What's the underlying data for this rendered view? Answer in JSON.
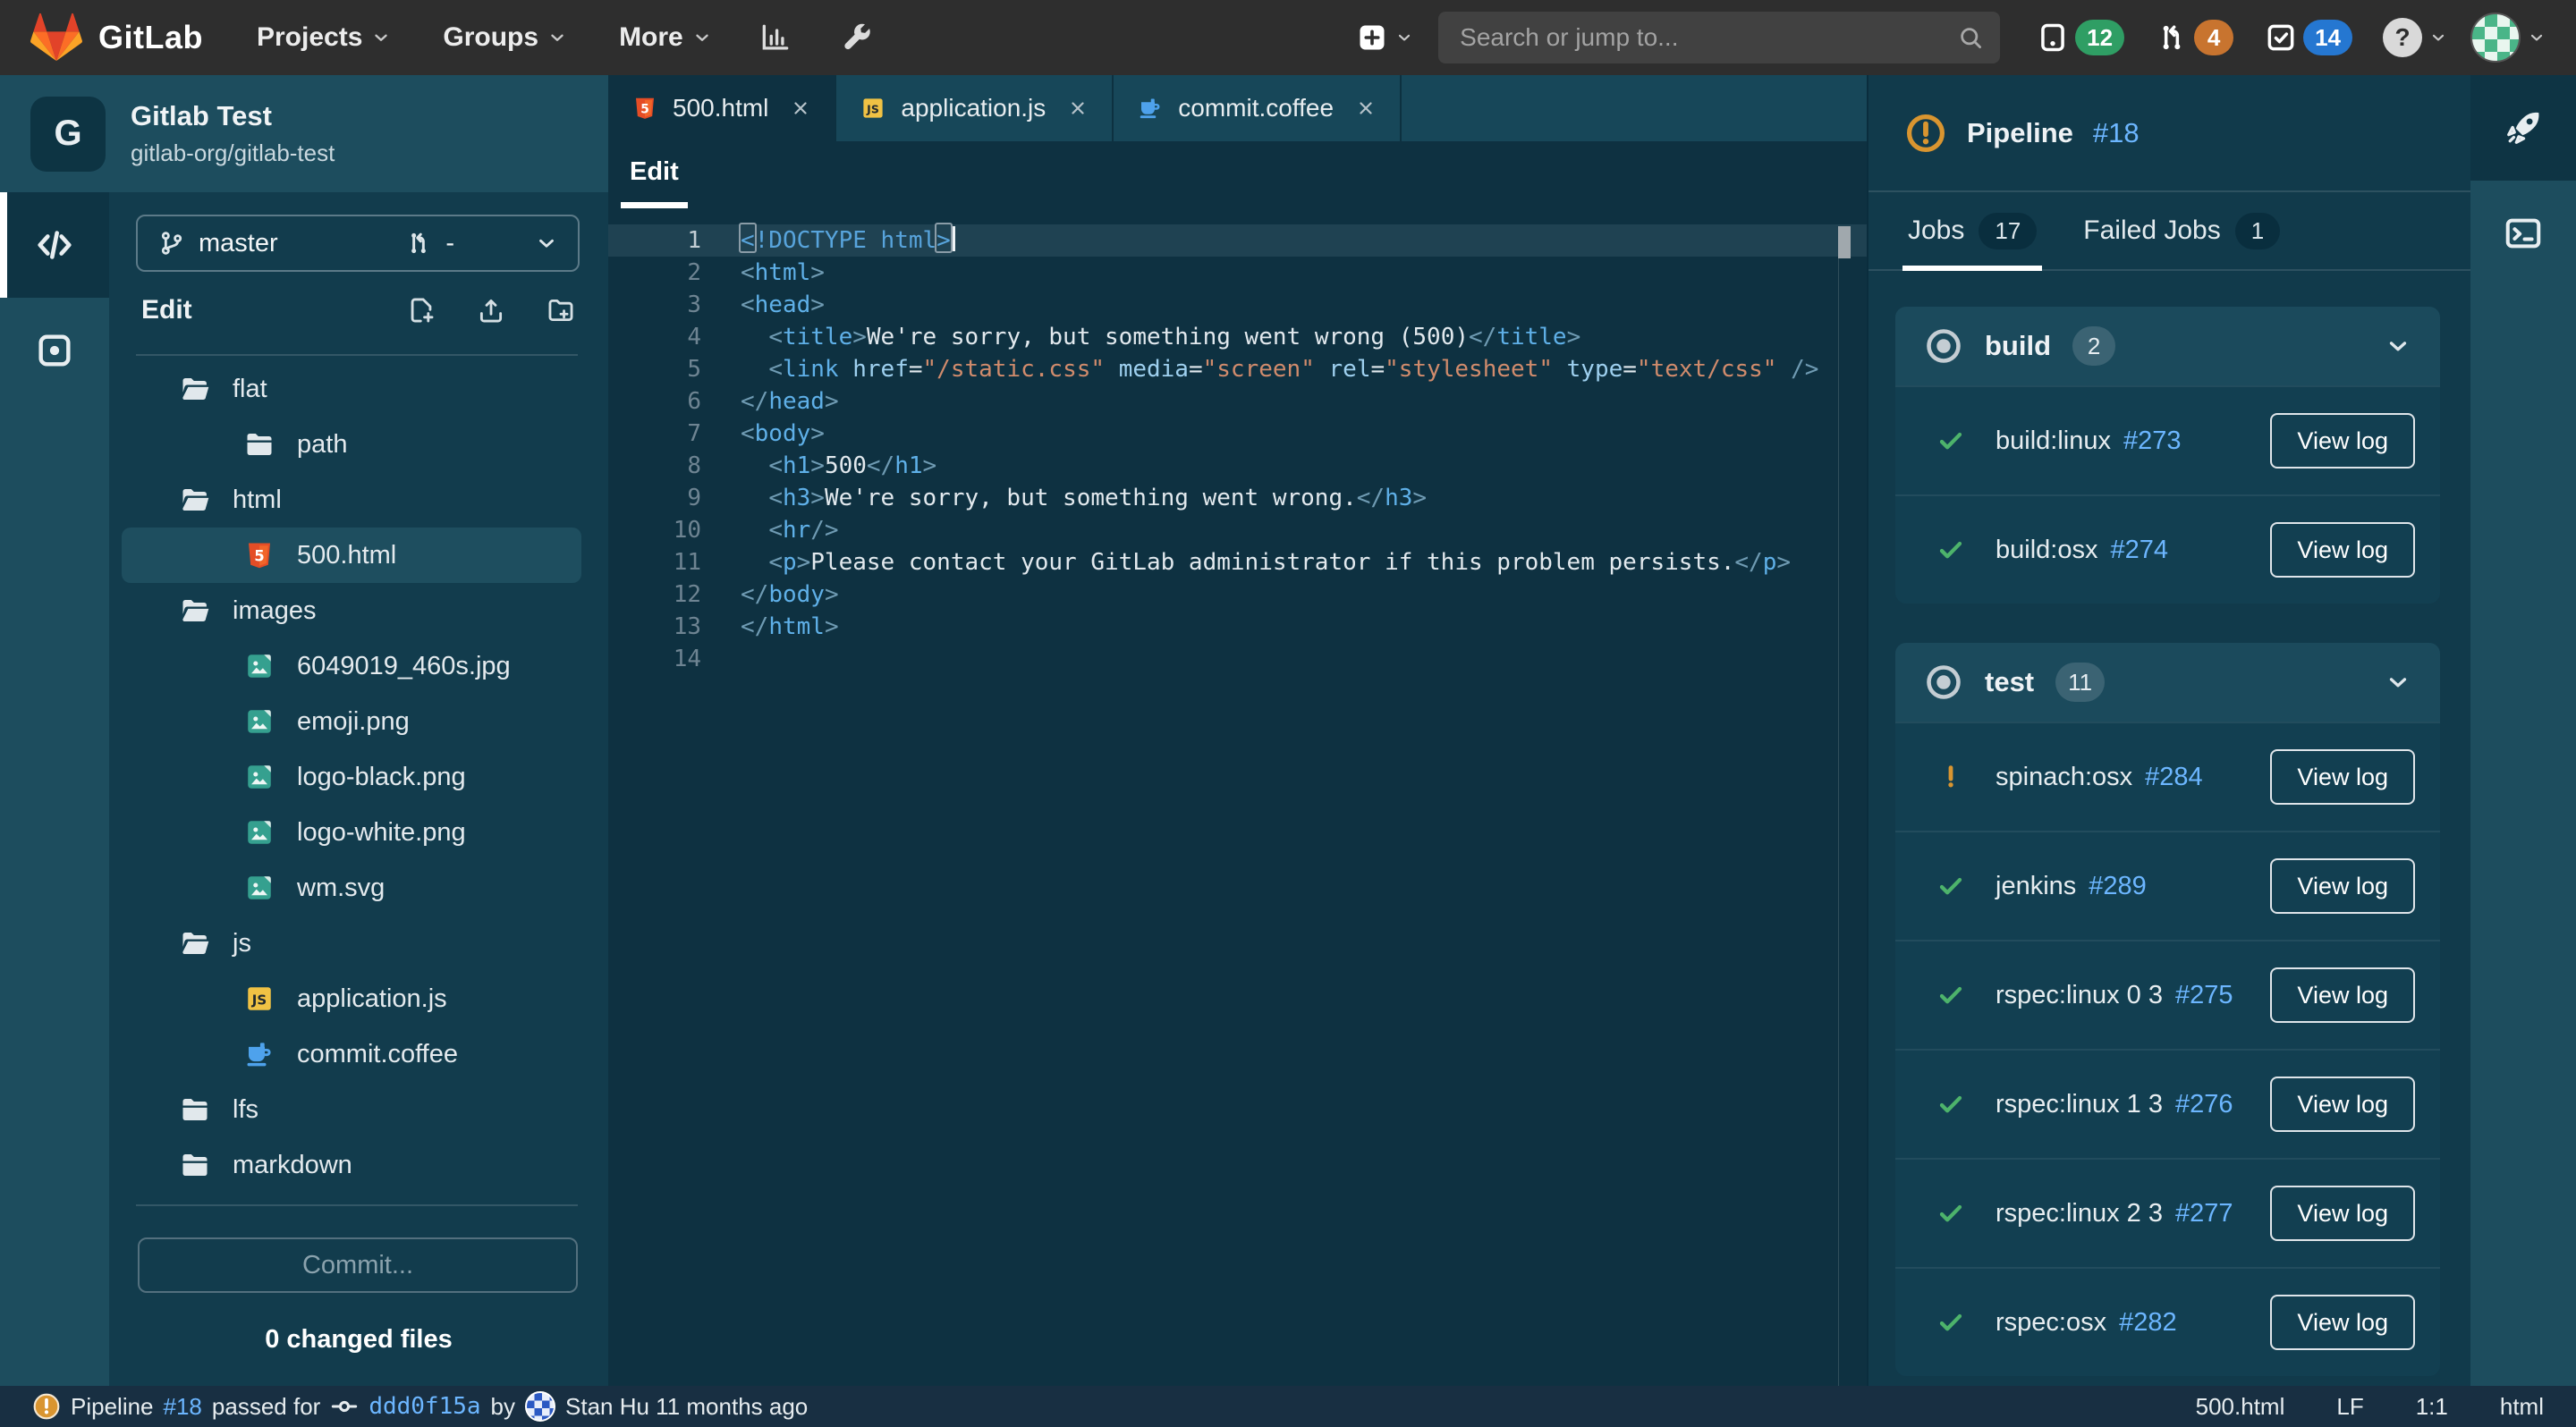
{
  "topbar": {
    "brand": "GitLab",
    "nav": [
      "Projects",
      "Groups",
      "More"
    ],
    "search_placeholder": "Search or jump to...",
    "badges": {
      "issues": "12",
      "merge_requests": "4",
      "todos": "14"
    },
    "help_glyph": "?"
  },
  "sidebar": {
    "project": {
      "initial": "G",
      "name": "Gitlab Test",
      "path": "gitlab-org/gitlab-test"
    },
    "branch": "master",
    "merge_request_value": "-",
    "section_label": "Edit",
    "tree": [
      {
        "name": "flat",
        "icon": "folder-open",
        "depth": 0
      },
      {
        "name": "path",
        "icon": "folder-closed",
        "depth": 1
      },
      {
        "name": "html",
        "icon": "folder-open",
        "depth": 0
      },
      {
        "name": "500.html",
        "icon": "html5",
        "depth": 1,
        "selected": true
      },
      {
        "name": "images",
        "icon": "folder-open",
        "depth": 0
      },
      {
        "name": "6049019_460s.jpg",
        "icon": "image",
        "depth": 1
      },
      {
        "name": "emoji.png",
        "icon": "image",
        "depth": 1
      },
      {
        "name": "logo-black.png",
        "icon": "image",
        "depth": 1
      },
      {
        "name": "logo-white.png",
        "icon": "image",
        "depth": 1
      },
      {
        "name": "wm.svg",
        "icon": "image",
        "depth": 1
      },
      {
        "name": "js",
        "icon": "folder-open",
        "depth": 0
      },
      {
        "name": "application.js",
        "icon": "js",
        "depth": 1
      },
      {
        "name": "commit.coffee",
        "icon": "coffee",
        "depth": 1
      },
      {
        "name": "lfs",
        "icon": "folder-closed",
        "depth": 0
      },
      {
        "name": "markdown",
        "icon": "folder-closed",
        "depth": 0
      }
    ],
    "commit_button": "Commit...",
    "changed_files": "0 changed files"
  },
  "editor": {
    "tabs": [
      {
        "label": "500.html",
        "icon": "html5",
        "active": true
      },
      {
        "label": "application.js",
        "icon": "js",
        "active": false
      },
      {
        "label": "commit.coffee",
        "icon": "coffee",
        "active": false
      }
    ],
    "mode_tab": "Edit",
    "lines": [
      {
        "num": "1",
        "active": true,
        "cursor": true,
        "segs": [
          [
            "xd",
            "<"
          ],
          [
            "d",
            "!DOCTYPE html"
          ],
          [
            "xd",
            ">"
          ]
        ]
      },
      {
        "num": "2",
        "segs": [
          [
            "b",
            "<"
          ],
          [
            "t",
            "html"
          ],
          [
            "b",
            ">"
          ]
        ]
      },
      {
        "num": "3",
        "segs": [
          [
            "b",
            "<"
          ],
          [
            "t",
            "head"
          ],
          [
            "b",
            ">"
          ]
        ]
      },
      {
        "num": "4",
        "segs": [
          [
            "p",
            "  "
          ],
          [
            "b",
            "<"
          ],
          [
            "t",
            "title"
          ],
          [
            "b",
            ">"
          ],
          [
            "p",
            "We're sorry, but something went wrong (500)"
          ],
          [
            "b",
            "</"
          ],
          [
            "t",
            "title"
          ],
          [
            "b",
            ">"
          ]
        ]
      },
      {
        "num": "5",
        "segs": [
          [
            "p",
            "  "
          ],
          [
            "b",
            "<"
          ],
          [
            "t",
            "link"
          ],
          [
            "p",
            " "
          ],
          [
            "a",
            "href"
          ],
          [
            "p",
            "="
          ],
          [
            "s",
            "\"/static.css\""
          ],
          [
            "p",
            " "
          ],
          [
            "a",
            "media"
          ],
          [
            "p",
            "="
          ],
          [
            "s",
            "\"screen\""
          ],
          [
            "p",
            " "
          ],
          [
            "a",
            "rel"
          ],
          [
            "p",
            "="
          ],
          [
            "s",
            "\"stylesheet\""
          ],
          [
            "p",
            " "
          ],
          [
            "a",
            "type"
          ],
          [
            "p",
            "="
          ],
          [
            "s",
            "\"text/css\""
          ],
          [
            "p",
            " "
          ],
          [
            "b",
            "/>"
          ]
        ]
      },
      {
        "num": "6",
        "segs": [
          [
            "b",
            "</"
          ],
          [
            "t",
            "head"
          ],
          [
            "b",
            ">"
          ]
        ]
      },
      {
        "num": "7",
        "segs": [
          [
            "b",
            "<"
          ],
          [
            "t",
            "body"
          ],
          [
            "b",
            ">"
          ]
        ]
      },
      {
        "num": "8",
        "segs": [
          [
            "p",
            "  "
          ],
          [
            "b",
            "<"
          ],
          [
            "t",
            "h1"
          ],
          [
            "b",
            ">"
          ],
          [
            "p",
            "500"
          ],
          [
            "b",
            "</"
          ],
          [
            "t",
            "h1"
          ],
          [
            "b",
            ">"
          ]
        ]
      },
      {
        "num": "9",
        "segs": [
          [
            "p",
            "  "
          ],
          [
            "b",
            "<"
          ],
          [
            "t",
            "h3"
          ],
          [
            "b",
            ">"
          ],
          [
            "p",
            "We're sorry, but something went wrong."
          ],
          [
            "b",
            "</"
          ],
          [
            "t",
            "h3"
          ],
          [
            "b",
            ">"
          ]
        ]
      },
      {
        "num": "10",
        "segs": [
          [
            "p",
            "  "
          ],
          [
            "b",
            "<"
          ],
          [
            "t",
            "hr"
          ],
          [
            "b",
            "/>"
          ]
        ]
      },
      {
        "num": "11",
        "segs": [
          [
            "p",
            "  "
          ],
          [
            "b",
            "<"
          ],
          [
            "t",
            "p"
          ],
          [
            "b",
            ">"
          ],
          [
            "p",
            "Please contact your GitLab administrator if this problem persists."
          ],
          [
            "b",
            "</"
          ],
          [
            "t",
            "p"
          ],
          [
            "b",
            ">"
          ]
        ]
      },
      {
        "num": "12",
        "segs": [
          [
            "b",
            "</"
          ],
          [
            "t",
            "body"
          ],
          [
            "b",
            ">"
          ]
        ]
      },
      {
        "num": "13",
        "segs": [
          [
            "b",
            "</"
          ],
          [
            "t",
            "html"
          ],
          [
            "b",
            ">"
          ]
        ]
      },
      {
        "num": "14",
        "segs": []
      }
    ]
  },
  "pipeline": {
    "title": "Pipeline",
    "number": "#18",
    "tabs": [
      {
        "label": "Jobs",
        "count": "17",
        "active": true
      },
      {
        "label": "Failed Jobs",
        "count": "1",
        "active": false
      }
    ],
    "view_log_label": "View log",
    "groups": [
      {
        "name": "build",
        "count": "2",
        "jobs": [
          {
            "status": "success",
            "name": "build:linux",
            "number": "#273"
          },
          {
            "status": "success",
            "name": "build:osx",
            "number": "#274"
          }
        ]
      },
      {
        "name": "test",
        "count": "11",
        "jobs": [
          {
            "status": "warning",
            "name": "spinach:osx",
            "number": "#284"
          },
          {
            "status": "success",
            "name": "jenkins",
            "number": "#289"
          },
          {
            "status": "success",
            "name": "rspec:linux 0 3",
            "number": "#275"
          },
          {
            "status": "success",
            "name": "rspec:linux 1 3",
            "number": "#276"
          },
          {
            "status": "success",
            "name": "rspec:linux 2 3",
            "number": "#277"
          },
          {
            "status": "success",
            "name": "rspec:osx",
            "number": "#282"
          }
        ]
      }
    ]
  },
  "statusbar": {
    "pipeline_label": "Pipeline",
    "pipeline_number": "#18",
    "passed_text": "passed for",
    "commit_sha": "ddd0f15a",
    "by_text": "by",
    "author_text": "Stan Hu 11 months ago",
    "right_items": [
      "500.html",
      "LF",
      "1:1",
      "html"
    ]
  },
  "colors": {
    "accent_blue": "#6cb6ff",
    "success_green": "#4db36b",
    "warning_orange": "#d99530",
    "badge_green": "#2f9e64",
    "badge_orange": "#c8742f",
    "badge_blue": "#2577d1"
  }
}
